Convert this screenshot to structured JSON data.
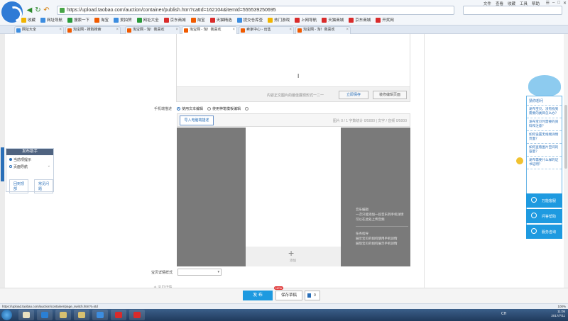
{
  "browser": {
    "url": "https://upload.taobao.com/auction/container/publish.htm?catId=162104&itemId=555539250695",
    "top_menu": [
      "文件",
      "查看",
      "收藏",
      "工具",
      "帮助"
    ],
    "window_controls": [
      "☰",
      "–",
      "□",
      "✕"
    ],
    "bookmarks": [
      {
        "label": "收藏",
        "color": "#f0b400"
      },
      {
        "label": "网址导航",
        "color": "#3c8de0"
      },
      {
        "label": "搜索一下",
        "color": "#2a9a3a"
      },
      {
        "label": "淘宝",
        "color": "#f05a00"
      },
      {
        "label": "爱拍赞",
        "color": "#3c8de0"
      },
      {
        "label": "网址大全",
        "color": "#2a9a3a"
      },
      {
        "label": "京东商城",
        "color": "#d92b2b"
      },
      {
        "label": "淘宝",
        "color": "#f05a00"
      },
      {
        "label": "天猫精选",
        "color": "#d92b2b"
      },
      {
        "label": "提交仓库查",
        "color": "#3c8de0"
      },
      {
        "label": "热门游戏",
        "color": "#f0b400"
      },
      {
        "label": "上网导航",
        "color": "#d92b2b"
      },
      {
        "label": "天猫商城",
        "color": "#d92b2b"
      },
      {
        "label": "京东商城",
        "color": "#d92b2b"
      },
      {
        "label": "开奖网",
        "color": "#d92b2b"
      }
    ],
    "tabs": [
      {
        "label": "网址大全",
        "color": "#3c8de0",
        "active": false
      },
      {
        "label": "淘宝网 - 搜狗搜索",
        "color": "#f05a00",
        "active": false
      },
      {
        "label": "淘宝网 - 淘！我喜欢",
        "color": "#f05a00",
        "active": false
      },
      {
        "label": "淘宝网 - 淘！我喜欢",
        "color": "#f05a00",
        "active": true
      },
      {
        "label": "卖家中心 - 出售",
        "color": "#f05a00",
        "active": false
      },
      {
        "label": "淘宝网 - 淘！我喜欢",
        "color": "#f05a00",
        "active": false
      }
    ]
  },
  "sidebar": {
    "header": "发布助手",
    "items": [
      "当前项提示",
      "页面导航"
    ],
    "buttons": [
      "回到顶部",
      "常见问题"
    ]
  },
  "editor": {
    "note": "内容正文图片的最佳展现形式一二一",
    "btn_a": "立即保存",
    "btn_b": "装修编辑页面"
  },
  "mobile": {
    "label": "手机端描述",
    "options": [
      "使用文本编辑",
      "使用神笔模板编辑"
    ],
    "import_btn": "导入电脑端描述",
    "info": "图片 0 / 1 字数统计 0/5000 | 文字 / 音频 0/5000",
    "add_label": "添加",
    "notes": [
      "音乐编辑",
      "一次只能添加一段音乐到手机详情",
      "可以在此处上传音频",
      "任务指导",
      "展示宝贝的如何使用手机详情",
      "展现宝贝的如何展示手机详情"
    ]
  },
  "template": {
    "label": "宝贝详情样式",
    "selected": ""
  },
  "cut_text": "＊ 宝贝详情",
  "help": {
    "title": "猜你想问",
    "questions": [
      "发布宝贝，没有找到需要的类目怎么办？",
      "发布宝贝时需要的资料和注意？",
      "如何设置无线端详情页面？",
      "如何查看图片空间的容量？",
      "发布需要什么样的证书证明？"
    ],
    "buttons": [
      "万能客服",
      "问答帮助",
      "服务咨询"
    ]
  },
  "actions": {
    "publish": "发 布",
    "draft": "保存草稿",
    "new_badge": "NEW",
    "mobile_count": "0"
  },
  "status": {
    "url": "https://upload.taobao.com/auction/container/page_switch.htm?t=std",
    "zoom": "100%"
  },
  "taskbar": {
    "apps": [
      "#e9e0c0",
      "#2a7fd4",
      "#d8c070",
      "#d8c070",
      "#3c8de0",
      "#d92b2b",
      "#d92b2b"
    ],
    "lang": "CH",
    "time": "11:05",
    "date": "2017/7/11"
  }
}
